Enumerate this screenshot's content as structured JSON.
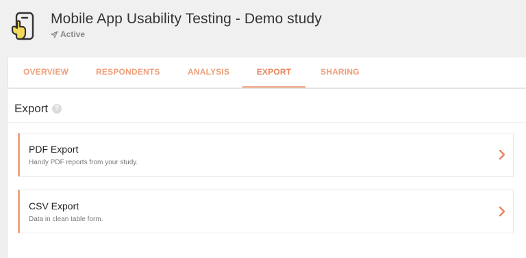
{
  "study": {
    "title": "Mobile App Usability Testing - Demo study",
    "status": "Active",
    "icon": "mobile-touch-icon"
  },
  "tabs": [
    {
      "label": "OVERVIEW"
    },
    {
      "label": "RESPONDENTS"
    },
    {
      "label": "ANALYSIS"
    },
    {
      "label": "EXPORT",
      "active": true
    },
    {
      "label": "SHARING"
    }
  ],
  "section": {
    "title": "Export",
    "help_icon": "help-icon"
  },
  "exports": [
    {
      "name": "PDF Export",
      "description": "Handy PDF reports from your study."
    },
    {
      "name": "CSV Export",
      "description": "Data in clean table form."
    }
  ],
  "colors": {
    "accent": "#e8845b",
    "accent_light": "#f0a683",
    "icon_yellow": "#f2d95a"
  }
}
